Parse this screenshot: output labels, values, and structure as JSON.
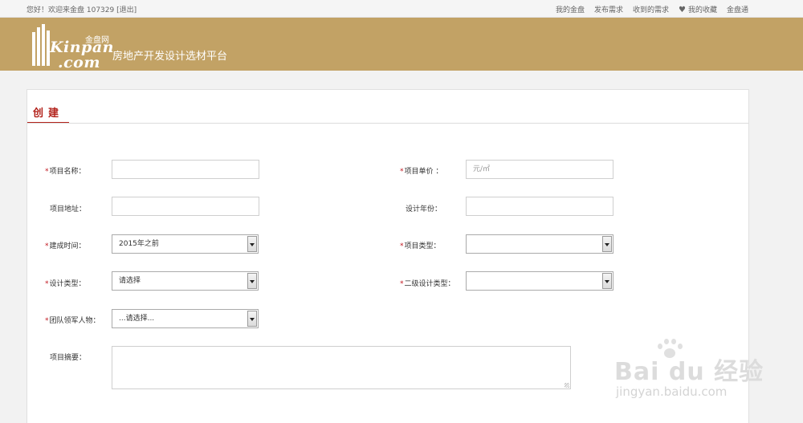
{
  "topbar": {
    "welcome": "您好！欢迎来金盘 107329",
    "logout": "[退出]",
    "links": [
      "我的金盘",
      "发布需求",
      "收到的需求",
      "我的收藏",
      "金盘通"
    ]
  },
  "header": {
    "logo_jp": "金盘网",
    "logo_line1": "Kinpan",
    "logo_line2": ".com",
    "slogan": "房地产开发设计选材平台"
  },
  "form": {
    "tab": "创建",
    "fields": {
      "project_name": {
        "label": "项目名称：",
        "value": ""
      },
      "project_price": {
        "label": "项目单价 ：",
        "placeholder": "元/㎡"
      },
      "project_address": {
        "label": "项目地址：",
        "value": ""
      },
      "design_year": {
        "label": "设计年份：",
        "value": ""
      },
      "build_time": {
        "label": "建成时间：",
        "selected": "2015年之前"
      },
      "project_type": {
        "label": "项目类型：",
        "selected": ""
      },
      "design_type": {
        "label": "设计类型：",
        "selected": "请选择"
      },
      "sub_design_type": {
        "label": "二级设计类型：",
        "selected": ""
      },
      "team_leader": {
        "label": "团队领军人物：",
        "selected": "...请选择..."
      },
      "summary": {
        "label": "项目摘要：",
        "value": ""
      }
    }
  },
  "watermark": {
    "brand": "Bai du 经验",
    "url": "jingyan.baidu.com"
  },
  "colors": {
    "banner": "#c2a265",
    "accent": "#b3231c",
    "required": "#c0141d"
  }
}
